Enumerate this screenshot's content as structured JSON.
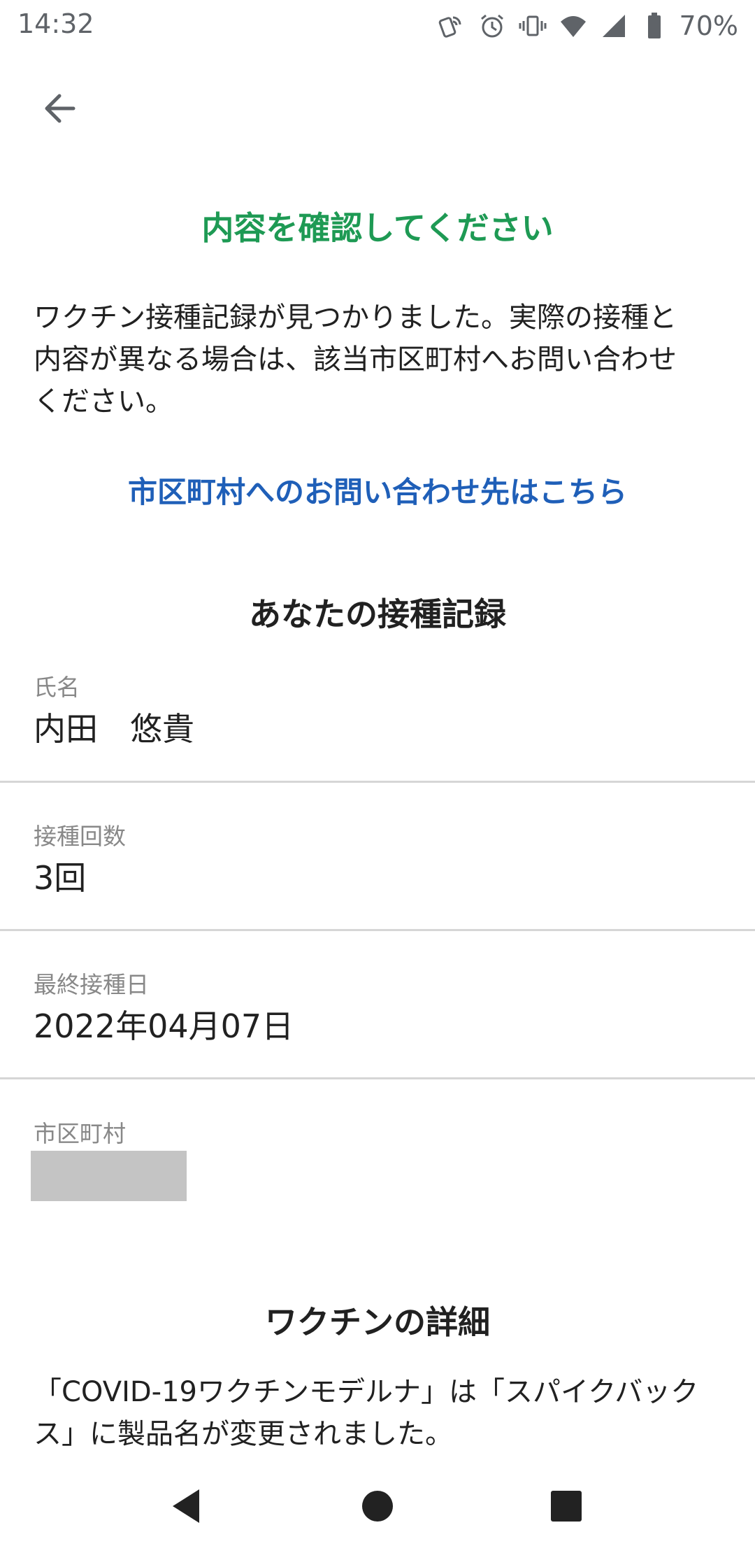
{
  "status_bar": {
    "time": "14:32",
    "battery": "70%",
    "icons": [
      "nfc-icon",
      "alarm-icon",
      "vibrate-icon",
      "wifi-icon",
      "signal-icon",
      "battery-icon"
    ]
  },
  "header": {
    "back_icon": "arrow-back-icon"
  },
  "main": {
    "title": "内容を確認してください",
    "intro_lines": [
      "ワクチン接種記録が見つかりました。実際の接種と",
      "内容が異なる場合は、該当市区町村へお問い合わせ",
      "ください。"
    ],
    "contact_link": "市区町村へのお問い合わせ先はこちら",
    "record_heading": "あなたの接種記録",
    "records": [
      {
        "label": "氏名",
        "value": "内田　悠貴"
      },
      {
        "label": "接種回数",
        "value": "3回"
      },
      {
        "label": "最終接種日",
        "value": "2022年04月07日"
      },
      {
        "label": "市区町村",
        "value": ""
      }
    ],
    "details_heading": "ワクチンの詳細",
    "details_lines": [
      "「COVID-19ワクチンモデルナ」は「スパイクバック",
      "ス」に製品名が変更されました。"
    ]
  },
  "nav_bar": {
    "icons": [
      "back-triangle-icon",
      "home-circle-icon",
      "recents-square-icon"
    ]
  },
  "colors": {
    "title_green": "#1e9a54",
    "link_blue": "#1f5fb8",
    "divider": "#d6d6d6",
    "redaction": "#c4c4c4"
  }
}
